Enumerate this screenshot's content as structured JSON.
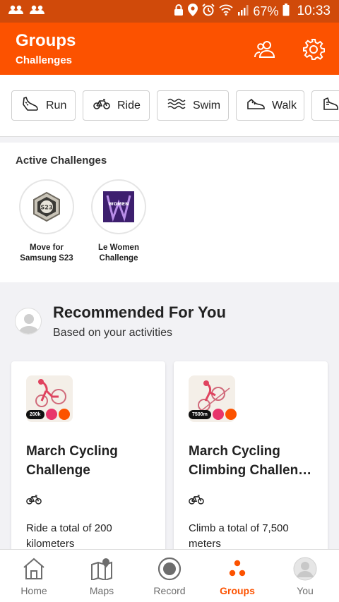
{
  "status_bar": {
    "battery_percent": "67%",
    "time": "10:33",
    "icons": [
      "group-notify-icon",
      "group-notify-icon",
      "lock-icon",
      "location-icon",
      "alarm-icon",
      "wifi-icon",
      "signal-icon",
      "battery-icon"
    ]
  },
  "header": {
    "title": "Groups",
    "subtitle": "Challenges",
    "icons": [
      "people-icon",
      "gear-icon"
    ],
    "background": "#fc5200"
  },
  "sports": [
    {
      "label": "Run",
      "icon": "shoe-icon"
    },
    {
      "label": "Ride",
      "icon": "bike-icon"
    },
    {
      "label": "Swim",
      "icon": "waves-icon"
    },
    {
      "label": "Walk",
      "icon": "walk-shoe-icon"
    },
    {
      "label": "",
      "icon": "hike-boot-icon"
    }
  ],
  "active_challenges": {
    "title": "Active Challenges",
    "items": [
      {
        "label_line1": "Move for",
        "label_line2": "Samsung S23",
        "badge_text": "S23"
      },
      {
        "label_line1": "Le Women",
        "label_line2": "Challenge",
        "badge_text": "WOMEN"
      }
    ]
  },
  "recommended": {
    "title": "Recommended For You",
    "subtitle": "Based on your activities",
    "cards": [
      {
        "title_line1": "March Cycling",
        "title_line2": "Challenge",
        "tag": "200k",
        "description": "Ride a total of 200 kilometers"
      },
      {
        "title_line1": "March Cycling",
        "title_line2": "Climbing Challen…",
        "tag": "7500m",
        "description": "Climb a total of 7,500 meters"
      }
    ]
  },
  "bottom_nav": [
    {
      "label": "Home",
      "icon": "home-icon",
      "active": false
    },
    {
      "label": "Maps",
      "icon": "map-icon",
      "active": false
    },
    {
      "label": "Record",
      "icon": "record-icon",
      "active": false
    },
    {
      "label": "Groups",
      "icon": "groups-icon",
      "active": true
    },
    {
      "label": "You",
      "icon": "avatar-icon",
      "active": false
    }
  ],
  "colors": {
    "accent": "#fc5200",
    "status_bar": "#d04a0a"
  }
}
